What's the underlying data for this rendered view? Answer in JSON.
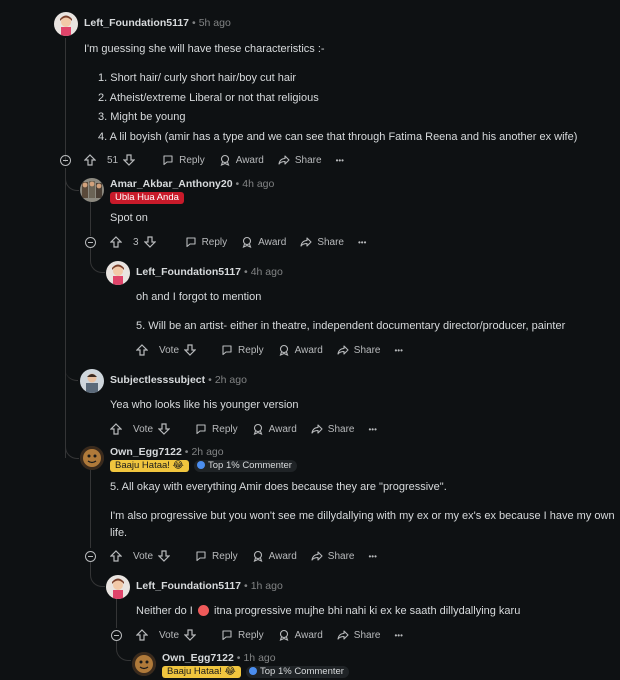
{
  "comments": [
    {
      "author": "Left_Foundation5117",
      "time": "5h ago",
      "intro": "I'm guessing she will have these characteristics :-",
      "list": [
        "1. Short hair/ curly short hair/boy cut hair",
        "2. Atheist/extreme Liberal or not that religious",
        "3. Might be young",
        "4. A lil boyish (amir has a type and we can see that through Fatima Reena and his another ex wife)"
      ],
      "votes": "51"
    },
    {
      "author": "Amar_Akbar_Anthony20",
      "time": "4h ago",
      "flair": "Ubla Hua Anda",
      "body": "Spot on",
      "votes": "3"
    },
    {
      "author": "Left_Foundation5117",
      "time": "4h ago",
      "body1": "oh and I forgot to mention",
      "body2": "5. Will be an artist- either in theatre, independent documentary director/producer, painter",
      "votes": "Vote"
    },
    {
      "author": "Subjectlesssubject",
      "time": "2h ago",
      "body": "Yea who looks like his younger version",
      "votes": "Vote"
    },
    {
      "author": "Own_Egg7122",
      "time": "2h ago",
      "flair": "Baaju Hataa! 😂",
      "badge": "Top 1% Commenter",
      "body1": "5. All okay with everything Amir does because they are \"progressive\".",
      "body2": "I'm also progressive but you won't see me dillydallying with my ex or my ex's ex because I have my own",
      "body3": "life.",
      "votes": "Vote"
    },
    {
      "author": "Left_Foundation5117",
      "time": "1h ago",
      "body_a": "Neither do I",
      "body_b": "itna progressive mujhe bhi nahi ki ex ke saath dillydallying karu",
      "votes": "Vote"
    },
    {
      "author": "Own_Egg7122",
      "time": "1h ago",
      "flair": "Baaju Hataa! 😂",
      "badge": "Top 1% Commenter"
    }
  ],
  "actions": {
    "reply": "Reply",
    "award": "Award",
    "share": "Share",
    "more": "•••"
  },
  "colors": {
    "background": "#0e1113",
    "thread_line": "#343536",
    "flair_red": "#c81a2a",
    "flair_yellow": "#f0c53e",
    "badge_blue": "#4b8ef0"
  }
}
